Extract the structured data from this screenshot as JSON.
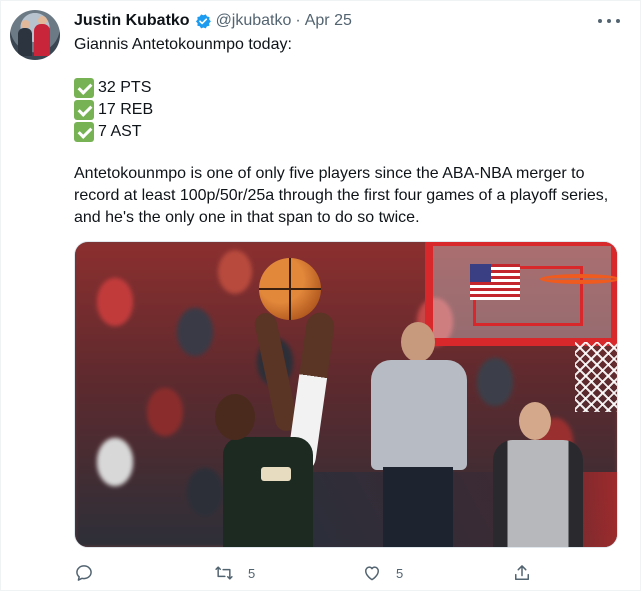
{
  "tweet": {
    "author_name": "Justin Kubatko",
    "handle": "@jkubatko",
    "separator": "·",
    "date": "Apr 25",
    "headline": "Giannis Antetokounmpo today:",
    "stats": [
      {
        "icon": "check-mark-icon",
        "text": "32 PTS"
      },
      {
        "icon": "check-mark-icon",
        "text": "17 REB"
      },
      {
        "icon": "check-mark-icon",
        "text": "7 AST"
      }
    ],
    "body": "Antetokounmpo is one of only five players since the ABA-NBA merger to record at least 100p/50r/25a through the first four games of a playoff series, and he's the only one in that span to do so twice."
  },
  "actions": {
    "reply_icon": "reply-icon",
    "retweet_icon": "retweet-icon",
    "retweet_count": "5",
    "like_icon": "heart-icon",
    "like_count": "5",
    "share_icon": "share-icon"
  },
  "colors": {
    "verified": "#1d9bf0",
    "check_emoji": "#77b255",
    "secondary_text": "#536471"
  }
}
